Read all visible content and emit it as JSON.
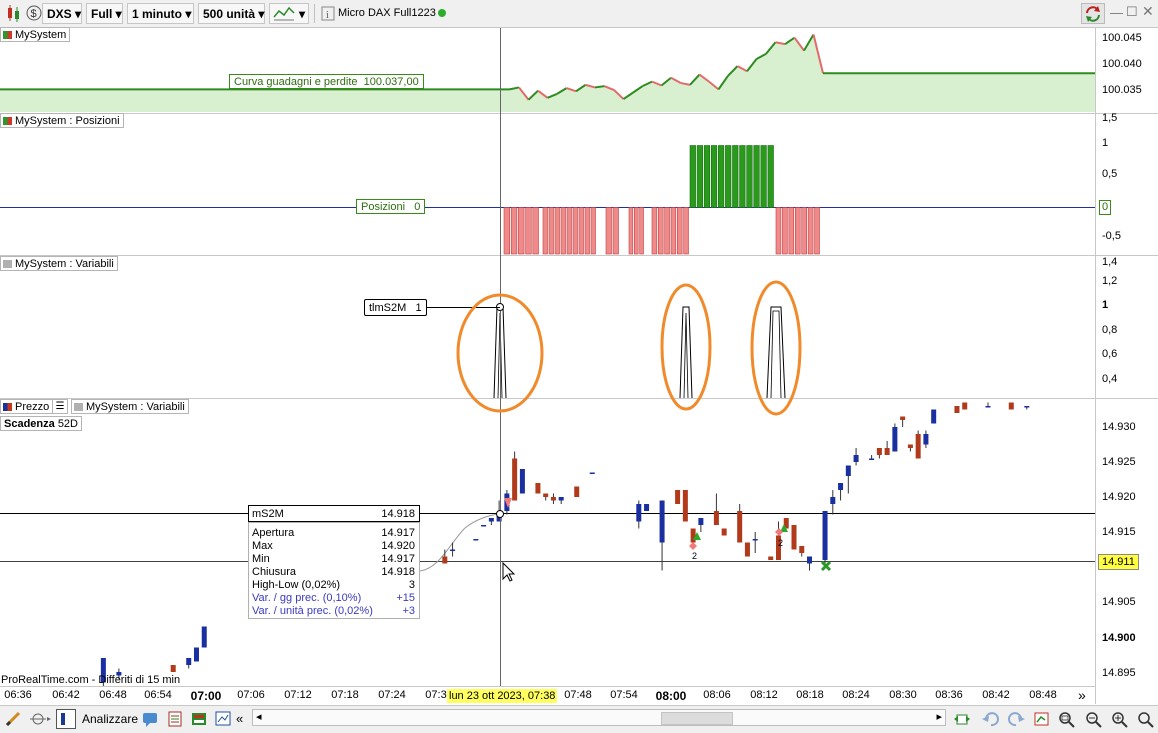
{
  "toolbar": {
    "symbol": "DXS",
    "mode": "Full",
    "timeframe": "1 minuto",
    "units": "500 unità",
    "instrument": "Micro DAX Full1223"
  },
  "panels": {
    "equity": {
      "label": "MySystem",
      "value_label": "Curva guadagni e perdite",
      "value": "100.037,00",
      "ticks": [
        "100.045",
        "100.040",
        "100.035"
      ]
    },
    "positions": {
      "label": "MySystem : Posizioni",
      "value_label": "Posizioni",
      "value": "0",
      "ticks": [
        "1,5",
        "1",
        "0,5",
        "-0,5"
      ],
      "right_value": "0"
    },
    "variables": {
      "label": "MySystem : Variabili",
      "value_label": "tlmS2M",
      "value": "1",
      "ticks": [
        "1,4",
        "1,2",
        "1",
        "0,8",
        "0,6",
        "0,4"
      ]
    },
    "price": {
      "tab_price": "Prezzo",
      "tab_vars": "MySystem : Variabili",
      "scadenza_label": "Scadenza",
      "scadenza_value": "52D",
      "ticks": [
        "14.930",
        "14.925",
        "14.920",
        "14.915",
        "14.910",
        "14.905",
        "14.900",
        "14.895"
      ],
      "last_price": "14.911",
      "ms2m_label": "mS2M",
      "ms2m_value": "14.918",
      "footer": "ProRealTime.com - Differiti di 15 min"
    }
  },
  "tooltip": {
    "rows": [
      {
        "label": "Apertura",
        "value": "14.917"
      },
      {
        "label": "Max",
        "value": "14.920"
      },
      {
        "label": "Min",
        "value": "14.917"
      },
      {
        "label": "Chiusura",
        "value": "14.918"
      },
      {
        "label": "High-Low (0,02%)",
        "value": "3"
      },
      {
        "label": "Var. / gg prec. (0,10%)",
        "value": "+15"
      },
      {
        "label": "Var. / unità prec. (0,02%)",
        "value": "+3"
      }
    ]
  },
  "time_axis": {
    "labels": [
      "06:36",
      "06:42",
      "06:48",
      "06:54",
      "07:00",
      "07:06",
      "07:12",
      "07:18",
      "07:24",
      "07:3",
      "07:48",
      "07:54",
      "08:00",
      "08:06",
      "08:12",
      "08:18",
      "08:24",
      "08:30",
      "08:36",
      "08:42",
      "08:48"
    ],
    "cursor_label": "lun 23 ott 2023, 07:38",
    "more": "»"
  },
  "bottombar": {
    "analyze_label": "Analizzare",
    "prev": "«"
  },
  "annotations": {
    "trade_count_1": "2",
    "trade_count_2": "2"
  },
  "colors": {
    "bull_candle": "#1a2fa0",
    "bear_candle": "#b03a1a",
    "equity_up": "#2e8b20",
    "equity_down": "#e26a6a",
    "short_bar": "#f08a8a",
    "long_bar": "#2a9a1a",
    "highlight": "#f08a2a",
    "cursor_date_bg": "#ffff80"
  },
  "chart_data": [
    {
      "type": "line",
      "title": "MySystem",
      "series": [
        {
          "name": "Curva guadagni e perdite",
          "values": [
            100037,
            100037,
            100037.3,
            100035.4,
            100036.8,
            100035.7,
            100036.3,
            100037.2,
            100036.7,
            100037.7,
            100037.3,
            100037.5,
            100036.9,
            100035.5,
            100036.5,
            100037.5,
            100038.2,
            100037.6,
            100038.8,
            100038.0,
            100037.7,
            100039.3,
            100038.2,
            100037.0,
            100039.1,
            100040.6,
            100039.8,
            100041.7,
            100042.5,
            100044.3,
            100044.0,
            100045.0,
            100043.0,
            100045.5,
            100039.5,
            100039.5
          ]
        }
      ],
      "ylim": [
        100033.5,
        100046.5
      ]
    },
    {
      "type": "bar",
      "title": "MySystem : Posizioni",
      "series": [
        {
          "name": "Posizioni",
          "values": [
            -1,
            1,
            0
          ]
        }
      ],
      "ylim": [
        -0.75,
        1.5
      ]
    },
    {
      "type": "line",
      "title": "MySystem : Variabili",
      "series": [
        {
          "name": "tlmS2M",
          "values": [
            0,
            1,
            0,
            1,
            0,
            1,
            1,
            0
          ]
        }
      ],
      "ylim": [
        0.3,
        1.4
      ]
    },
    {
      "type": "bar",
      "title": "Prezzo",
      "ylim": [
        14.8935,
        14.9345
      ],
      "candles": [
        {
          "t": "06:47",
          "o": 14.894,
          "h": 14.8975,
          "l": 14.8935,
          "c": 14.8975
        },
        {
          "t": "06:49",
          "o": 14.895,
          "h": 14.896,
          "l": 14.8945,
          "c": 14.8955
        },
        {
          "t": "06:56",
          "o": 14.8965,
          "h": 14.8965,
          "l": 14.8955,
          "c": 14.8955
        },
        {
          "t": "06:58",
          "o": 14.8965,
          "h": 14.8975,
          "l": 14.896,
          "c": 14.8975
        },
        {
          "t": "06:59",
          "o": 14.897,
          "h": 14.899,
          "l": 14.897,
          "c": 14.899
        },
        {
          "t": "07:00",
          "o": 14.899,
          "h": 14.902,
          "l": 14.899,
          "c": 14.902
        },
        {
          "t": "07:31",
          "o": 14.912,
          "h": 14.913,
          "l": 14.911,
          "c": 14.911
        },
        {
          "t": "07:32",
          "o": 14.913,
          "h": 14.914,
          "l": 14.912,
          "c": 14.913
        },
        {
          "t": "07:35",
          "o": 14.9145,
          "h": 14.9145,
          "l": 14.9145,
          "c": 14.9145
        },
        {
          "t": "07:36",
          "o": 14.9165,
          "h": 14.9165,
          "l": 14.9165,
          "c": 14.9165
        },
        {
          "t": "07:37",
          "o": 14.917,
          "h": 14.9175,
          "l": 14.9165,
          "c": 14.9175
        },
        {
          "t": "07:38",
          "o": 14.917,
          "h": 14.92,
          "l": 14.917,
          "c": 14.918
        },
        {
          "t": "07:39",
          "o": 14.9185,
          "h": 14.9215,
          "l": 14.918,
          "c": 14.921
        },
        {
          "t": "07:40",
          "o": 14.926,
          "h": 14.927,
          "l": 14.92,
          "c": 14.92
        },
        {
          "t": "07:41",
          "o": 14.921,
          "h": 14.9245,
          "l": 14.921,
          "c": 14.9245
        },
        {
          "t": "07:43",
          "o": 14.9225,
          "h": 14.9225,
          "l": 14.921,
          "c": 14.921
        },
        {
          "t": "07:44",
          "o": 14.921,
          "h": 14.921,
          "l": 14.92,
          "c": 14.9205
        },
        {
          "t": "07:45",
          "o": 14.9205,
          "h": 14.921,
          "l": 14.9195,
          "c": 14.92
        },
        {
          "t": "07:46",
          "o": 14.92,
          "h": 14.9205,
          "l": 14.9195,
          "c": 14.9205
        },
        {
          "t": "07:48",
          "o": 14.922,
          "h": 14.922,
          "l": 14.9205,
          "c": 14.9205
        },
        {
          "t": "07:50",
          "o": 14.924,
          "h": 14.924,
          "l": 14.924,
          "c": 14.924
        },
        {
          "t": "07:56",
          "o": 14.917,
          "h": 14.92,
          "l": 14.916,
          "c": 14.9195
        },
        {
          "t": "07:57",
          "o": 14.9185,
          "h": 14.9195,
          "l": 14.9185,
          "c": 14.9195
        },
        {
          "t": "07:59",
          "o": 14.914,
          "h": 14.92,
          "l": 14.91,
          "c": 14.92
        },
        {
          "t": "08:01",
          "o": 14.9215,
          "h": 14.9215,
          "l": 14.9195,
          "c": 14.9195
        },
        {
          "t": "08:02",
          "o": 14.9215,
          "h": 14.9215,
          "l": 14.917,
          "c": 14.917
        },
        {
          "t": "08:03",
          "o": 14.916,
          "h": 14.916,
          "l": 14.913,
          "c": 14.914
        },
        {
          "t": "08:04",
          "o": 14.9165,
          "h": 14.9175,
          "l": 14.9155,
          "c": 14.9175
        },
        {
          "t": "08:06",
          "o": 14.9185,
          "h": 14.921,
          "l": 14.9165,
          "c": 14.9165
        },
        {
          "t": "08:07",
          "o": 14.916,
          "h": 14.916,
          "l": 14.915,
          "c": 14.915
        },
        {
          "t": "08:09",
          "o": 14.9185,
          "h": 14.9195,
          "l": 14.914,
          "c": 14.914
        },
        {
          "t": "08:10",
          "o": 14.914,
          "h": 14.914,
          "l": 14.912,
          "c": 14.912
        },
        {
          "t": "08:11",
          "o": 14.9145,
          "h": 14.9155,
          "l": 14.9125,
          "c": 14.9145
        },
        {
          "t": "08:13",
          "o": 14.912,
          "h": 14.912,
          "l": 14.9115,
          "c": 14.9115
        },
        {
          "t": "08:14",
          "o": 14.915,
          "h": 14.917,
          "l": 14.9115,
          "c": 14.9115
        },
        {
          "t": "08:15",
          "o": 14.9175,
          "h": 14.9175,
          "l": 14.916,
          "c": 14.916
        },
        {
          "t": "08:16",
          "o": 14.9165,
          "h": 14.9165,
          "l": 14.913,
          "c": 14.913
        },
        {
          "t": "08:17",
          "o": 14.9135,
          "h": 14.9135,
          "l": 14.912,
          "c": 14.9125
        },
        {
          "t": "08:18",
          "o": 14.911,
          "h": 14.912,
          "l": 14.91,
          "c": 14.912
        },
        {
          "t": "08:20",
          "o": 14.9115,
          "h": 14.9175,
          "l": 14.9105,
          "c": 14.9185
        },
        {
          "t": "08:21",
          "o": 14.9195,
          "h": 14.9215,
          "l": 14.918,
          "c": 14.9205
        },
        {
          "t": "08:22",
          "o": 14.9215,
          "h": 14.9225,
          "l": 14.92,
          "c": 14.9225
        },
        {
          "t": "08:23",
          "o": 14.9235,
          "h": 14.925,
          "l": 14.921,
          "c": 14.925
        },
        {
          "t": "08:24",
          "o": 14.9255,
          "h": 14.9275,
          "l": 14.925,
          "c": 14.9265
        },
        {
          "t": "08:26",
          "o": 14.926,
          "h": 14.9265,
          "l": 14.926,
          "c": 14.926
        },
        {
          "t": "08:27",
          "o": 14.9275,
          "h": 14.9275,
          "l": 14.926,
          "c": 14.9265
        },
        {
          "t": "08:28",
          "o": 14.9275,
          "h": 14.9285,
          "l": 14.9265,
          "c": 14.9265
        },
        {
          "t": "08:29",
          "o": 14.927,
          "h": 14.931,
          "l": 14.927,
          "c": 14.9305
        },
        {
          "t": "08:30",
          "o": 14.932,
          "h": 14.932,
          "l": 14.9305,
          "c": 14.9315
        },
        {
          "t": "08:31",
          "o": 14.928,
          "h": 14.928,
          "l": 14.927,
          "c": 14.9275
        },
        {
          "t": "08:32",
          "o": 14.9295,
          "h": 14.93,
          "l": 14.926,
          "c": 14.926
        },
        {
          "t": "08:33",
          "o": 14.928,
          "h": 14.93,
          "l": 14.9275,
          "c": 14.9295
        },
        {
          "t": "08:34",
          "o": 14.931,
          "h": 14.933,
          "l": 14.931,
          "c": 14.933
        },
        {
          "t": "08:37",
          "o": 14.9335,
          "h": 14.9335,
          "l": 14.9325,
          "c": 14.9325
        },
        {
          "t": "08:38",
          "o": 14.934,
          "h": 14.934,
          "l": 14.933,
          "c": 14.933
        },
        {
          "t": "08:41",
          "o": 14.9335,
          "h": 14.934,
          "l": 14.9335,
          "c": 14.9335
        },
        {
          "t": "08:44",
          "o": 14.934,
          "h": 14.934,
          "l": 14.933,
          "c": 14.933
        },
        {
          "t": "08:46",
          "o": 14.9335,
          "h": 14.9335,
          "l": 14.933,
          "c": 14.9335
        }
      ]
    }
  ]
}
